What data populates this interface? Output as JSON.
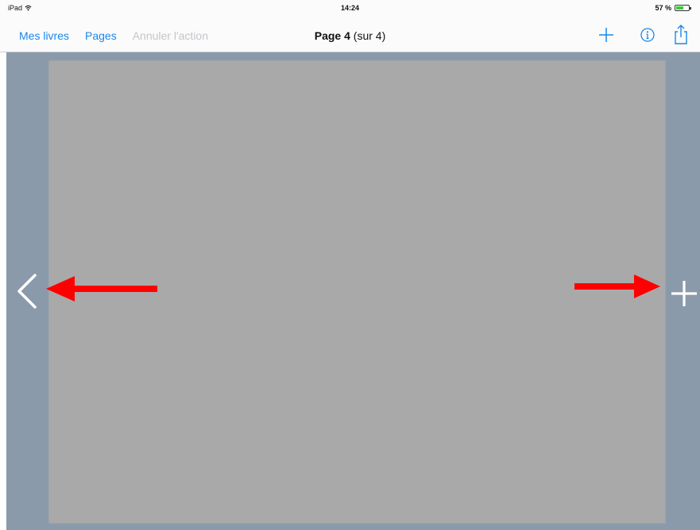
{
  "status_bar": {
    "device": "iPad",
    "time": "14:24",
    "battery_text": "57 %",
    "battery_level": 0.57
  },
  "nav": {
    "left_items": [
      {
        "label": "Mes livres",
        "enabled": true
      },
      {
        "label": "Pages",
        "enabled": true
      },
      {
        "label": "Annuler l'action",
        "enabled": false
      }
    ],
    "title_bold": "Page 4",
    "title_rest": "(sur 4)",
    "right_icons": [
      "plus-icon",
      "info-icon",
      "share-icon"
    ]
  },
  "side_controls": {
    "left_icon": "chevron-left-icon",
    "right_icon": "plus-icon"
  },
  "annotations": {
    "arrow_color": "#ff0000"
  },
  "colors": {
    "accent": "#1a87ea",
    "disabled": "#c2c5ca",
    "workspace_bg": "#8a9aaa",
    "page_bg": "#a9a9a9"
  }
}
